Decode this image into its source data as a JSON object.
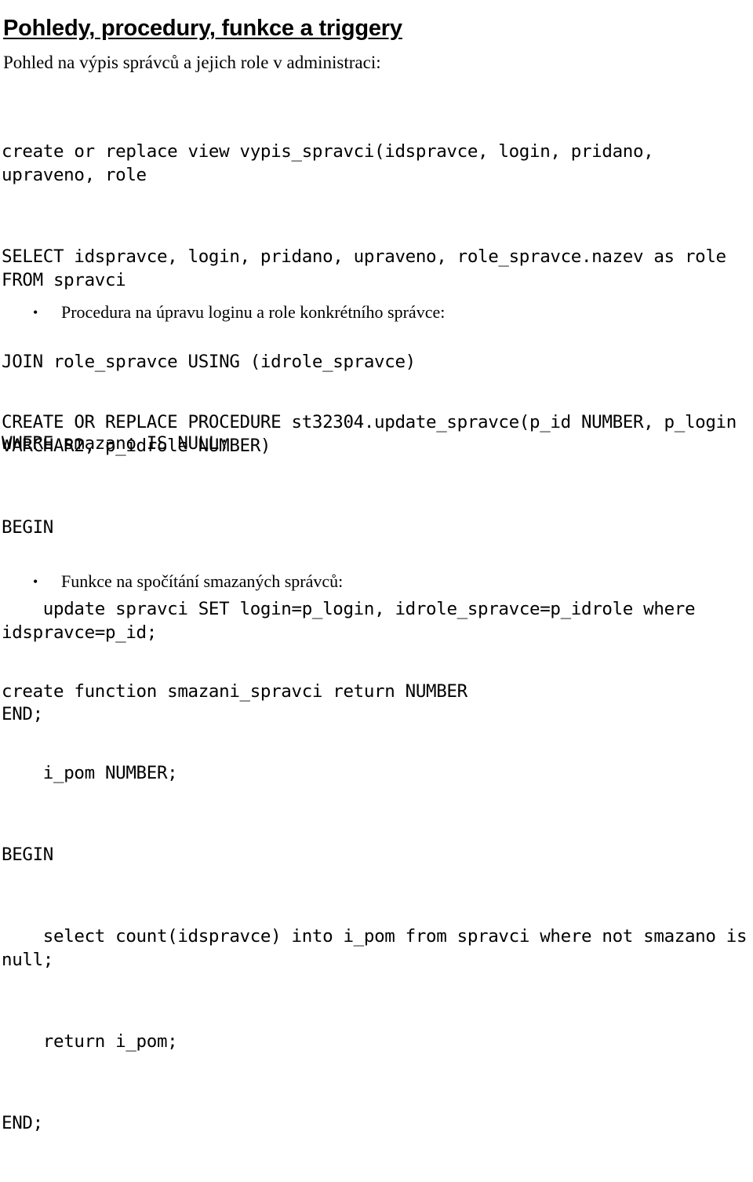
{
  "document": {
    "title": "Pohledy, procedury, funkce a triggery",
    "intro": "Pohled na výpis správců a jejich role v administraci:",
    "bullet_marker": "•",
    "colors": {
      "background": "#ffffff",
      "text": "#000000"
    }
  },
  "sections": {
    "view_code": {
      "line1": "create or replace view vypis_spravci(idspravce, login, pridano, upraveno, role",
      "line2": "SELECT idspravce, login, pridano, upraveno, role_spravce.nazev as role FROM spravci",
      "line3": "JOIN role_spravce USING (idrole_spravce)",
      "line4": "WHERE smazano IS NULL;"
    },
    "bullet_procedure": "Procedura na úpravu loginu a role konkrétního správce:",
    "procedure_code": {
      "line1": "CREATE OR REPLACE PROCEDURE st32304.update_spravce(p_id NUMBER, p_login VARCHAR2, p_idrole NUMBER)",
      "line2": "BEGIN",
      "line3": "    update spravci SET login=p_login, idrole_spravce=p_idrole where idspravce=p_id;",
      "line4": "END;"
    },
    "bullet_function": "Funkce na spočítání smazaných správců:",
    "function_code": {
      "line1": "create function smazani_spravci return NUMBER",
      "line2": "    i_pom NUMBER;",
      "line3": "BEGIN",
      "line4": "    select count(idspravce) into i_pom from spravci where not smazano is null;",
      "line5": "    return i_pom;",
      "line6": "END;"
    }
  }
}
